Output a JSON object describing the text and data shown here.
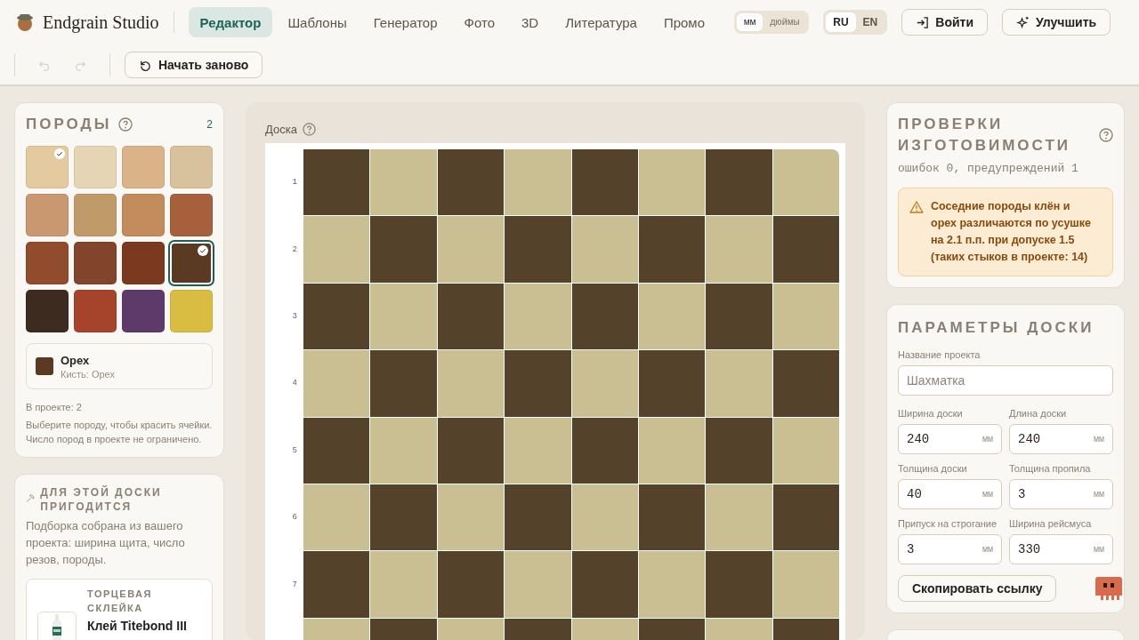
{
  "header": {
    "brand": "Endgrain Studio",
    "tabs": [
      {
        "label": "Редактор",
        "selected": true
      },
      {
        "label": "Шаблоны",
        "selected": false
      },
      {
        "label": "Генератор",
        "selected": false
      },
      {
        "label": "Фото",
        "selected": false
      },
      {
        "label": "3D",
        "selected": false
      },
      {
        "label": "Литература",
        "selected": false
      },
      {
        "label": "Промо",
        "selected": false
      }
    ],
    "units": [
      {
        "label": "мм",
        "selected": true
      },
      {
        "label": "дюймы",
        "selected": false
      }
    ],
    "languages": [
      {
        "label": "RU",
        "selected": true
      },
      {
        "label": "EN",
        "selected": false
      }
    ],
    "login_button": "Войти",
    "upgrade_button": "Улучшить"
  },
  "toolbar": {
    "undo": {
      "disabled": true
    },
    "redo": {
      "disabled": true
    },
    "restart_button": "Начать заново"
  },
  "species": {
    "title": "ПОРОДЫ",
    "count": "2",
    "swatches": [
      {
        "color": "#e3cb9f",
        "selected": false,
        "in_project": true
      },
      {
        "color": "#e6d5b5",
        "selected": false,
        "in_project": false
      },
      {
        "color": "#dbb389",
        "selected": false,
        "in_project": false
      },
      {
        "color": "#d8c29e",
        "selected": false,
        "in_project": false
      },
      {
        "color": "#c99870",
        "selected": false,
        "in_project": false
      },
      {
        "color": "#c09a68",
        "selected": false,
        "in_project": false
      },
      {
        "color": "#c28c5c",
        "selected": false,
        "in_project": false
      },
      {
        "color": "#a6613c",
        "selected": false,
        "in_project": false
      },
      {
        "color": "#914c2e",
        "selected": false,
        "in_project": false
      },
      {
        "color": "#82452b",
        "selected": false,
        "in_project": false
      },
      {
        "color": "#7b3a20",
        "selected": false,
        "in_project": false
      },
      {
        "color": "#5a3a22",
        "selected": true,
        "in_project": true
      },
      {
        "color": "#3d2b20",
        "selected": false,
        "in_project": false
      },
      {
        "color": "#a6432b",
        "selected": false,
        "in_project": false
      },
      {
        "color": "#5e3a6a",
        "selected": false,
        "in_project": false
      },
      {
        "color": "#d9bd42",
        "selected": false,
        "in_project": false
      }
    ],
    "current": {
      "name": "Орех",
      "brush": "Кисть: Орех",
      "color": "#5a3a22"
    },
    "in_project": "В проекте: 2",
    "hint": "Выберите породу, чтобы красить ячейки. Число пород в проекте не ограничено."
  },
  "recommendations": {
    "title": "ДЛЯ ЭТОЙ ДОСКИ ПРИГОДИТСЯ",
    "text": "Подборка собрана из вашего проекта: ширина щита, число резов, породы.",
    "product": {
      "category": "ТОРЦЕВАЯ СКЛЕЙКА",
      "name": "Клей Titebond III"
    }
  },
  "board": {
    "label": "Доска",
    "rows": [
      {
        "label": "1",
        "cells": [
          {
            "color": "#54432a"
          },
          {
            "color": "#c9bf92"
          },
          {
            "color": "#54432a"
          },
          {
            "color": "#c9bf92"
          },
          {
            "color": "#54432a"
          },
          {
            "color": "#c9bf92"
          },
          {
            "color": "#54432a"
          },
          {
            "color": "#c9bf92"
          }
        ]
      },
      {
        "label": "2",
        "cells": [
          {
            "color": "#c9bf92"
          },
          {
            "color": "#54432a"
          },
          {
            "color": "#c9bf92"
          },
          {
            "color": "#54432a"
          },
          {
            "color": "#c9bf92"
          },
          {
            "color": "#54432a"
          },
          {
            "color": "#c9bf92"
          },
          {
            "color": "#54432a"
          }
        ]
      },
      {
        "label": "3",
        "cells": [
          {
            "color": "#54432a"
          },
          {
            "color": "#c9bf92"
          },
          {
            "color": "#54432a"
          },
          {
            "color": "#c9bf92"
          },
          {
            "color": "#54432a"
          },
          {
            "color": "#c9bf92"
          },
          {
            "color": "#54432a"
          },
          {
            "color": "#c9bf92"
          }
        ]
      },
      {
        "label": "4",
        "cells": [
          {
            "color": "#c9bf92"
          },
          {
            "color": "#54432a"
          },
          {
            "color": "#c9bf92"
          },
          {
            "color": "#54432a"
          },
          {
            "color": "#c9bf92"
          },
          {
            "color": "#54432a"
          },
          {
            "color": "#c9bf92"
          },
          {
            "color": "#54432a"
          }
        ]
      },
      {
        "label": "5",
        "cells": [
          {
            "color": "#54432a"
          },
          {
            "color": "#c9bf92"
          },
          {
            "color": "#54432a"
          },
          {
            "color": "#c9bf92"
          },
          {
            "color": "#54432a"
          },
          {
            "color": "#c9bf92"
          },
          {
            "color": "#54432a"
          },
          {
            "color": "#c9bf92"
          }
        ]
      },
      {
        "label": "6",
        "cells": [
          {
            "color": "#c9bf92"
          },
          {
            "color": "#54432a"
          },
          {
            "color": "#c9bf92"
          },
          {
            "color": "#54432a"
          },
          {
            "color": "#c9bf92"
          },
          {
            "color": "#54432a"
          },
          {
            "color": "#c9bf92"
          },
          {
            "color": "#54432a"
          }
        ]
      },
      {
        "label": "7",
        "cells": [
          {
            "color": "#54432a"
          },
          {
            "color": "#c9bf92"
          },
          {
            "color": "#54432a"
          },
          {
            "color": "#c9bf92"
          },
          {
            "color": "#54432a"
          },
          {
            "color": "#c9bf92"
          },
          {
            "color": "#54432a"
          },
          {
            "color": "#c9bf92"
          }
        ]
      },
      {
        "cells": [
          {
            "color": "#c9bf92"
          },
          {
            "color": "#54432a"
          },
          {
            "color": "#c9bf92"
          },
          {
            "color": "#54432a"
          },
          {
            "color": "#c9bf92"
          },
          {
            "color": "#54432a"
          },
          {
            "color": "#c9bf92"
          },
          {
            "color": "#54432a"
          }
        ]
      }
    ]
  },
  "checks": {
    "title": "ПРОВЕРКИ ИЗГОТОВИМОСТИ",
    "summary": "ошибок 0, предупреждений 1",
    "warnings": [
      "Соседние породы клён и орех различаются по усушке на 2.1 п.п. при допуске 1.5 (таких стыков в проекте: 14)"
    ]
  },
  "params": {
    "title": "ПАРАМЕТРЫ ДОСКИ",
    "name_label": "Название проекта",
    "name_placeholder": "Шахматка",
    "fields": [
      {
        "label": "Ширина доски",
        "value": "240",
        "unit": "мм"
      },
      {
        "label": "Длина доски",
        "value": "240",
        "unit": "мм"
      },
      {
        "label": "Толщина доски",
        "value": "40",
        "unit": "мм"
      },
      {
        "label": "Толщина пропила",
        "value": "3",
        "unit": "мм"
      },
      {
        "label": "Припуск на строгание",
        "value": "3",
        "unit": "мм"
      },
      {
        "label": "Ширина рейсмуса",
        "value": "330",
        "unit": "мм"
      }
    ],
    "copy_button": "Скопировать ссылку"
  }
}
